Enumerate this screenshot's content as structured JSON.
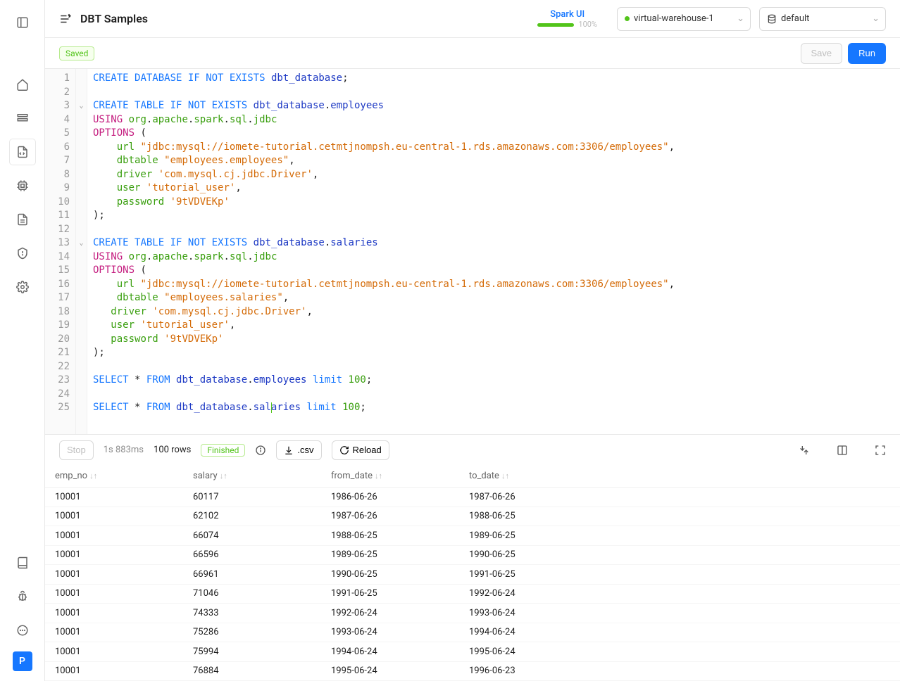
{
  "header": {
    "title": "DBT Samples",
    "spark_label": "Spark UI",
    "spark_pct": "100%",
    "warehouse": "virtual-warehouse-1",
    "database": "default"
  },
  "toolbar": {
    "saved": "Saved",
    "save": "Save",
    "run": "Run"
  },
  "code": {
    "lines": [
      "1",
      "2",
      "3",
      "4",
      "5",
      "6",
      "7",
      "8",
      "9",
      "10",
      "11",
      "12",
      "13",
      "14",
      "15",
      "16",
      "17",
      "18",
      "19",
      "20",
      "21",
      "22",
      "23",
      "24",
      "25"
    ]
  },
  "results": {
    "stop": "Stop",
    "duration": "1s 883ms",
    "rowcount": "100 rows",
    "status": "Finished",
    "csv": ".csv",
    "reload": "Reload"
  },
  "table": {
    "headers": [
      "emp_no",
      "salary",
      "from_date",
      "to_date"
    ],
    "rows": [
      [
        "10001",
        "60117",
        "1986-06-26",
        "1987-06-26"
      ],
      [
        "10001",
        "62102",
        "1987-06-26",
        "1988-06-25"
      ],
      [
        "10001",
        "66074",
        "1988-06-25",
        "1989-06-25"
      ],
      [
        "10001",
        "66596",
        "1989-06-25",
        "1990-06-25"
      ],
      [
        "10001",
        "66961",
        "1990-06-25",
        "1991-06-25"
      ],
      [
        "10001",
        "71046",
        "1991-06-25",
        "1992-06-24"
      ],
      [
        "10001",
        "74333",
        "1992-06-24",
        "1993-06-24"
      ],
      [
        "10001",
        "75286",
        "1993-06-24",
        "1994-06-24"
      ],
      [
        "10001",
        "75994",
        "1994-06-24",
        "1995-06-24"
      ],
      [
        "10001",
        "76884",
        "1995-06-24",
        "1996-06-23"
      ]
    ]
  },
  "avatar": "P"
}
